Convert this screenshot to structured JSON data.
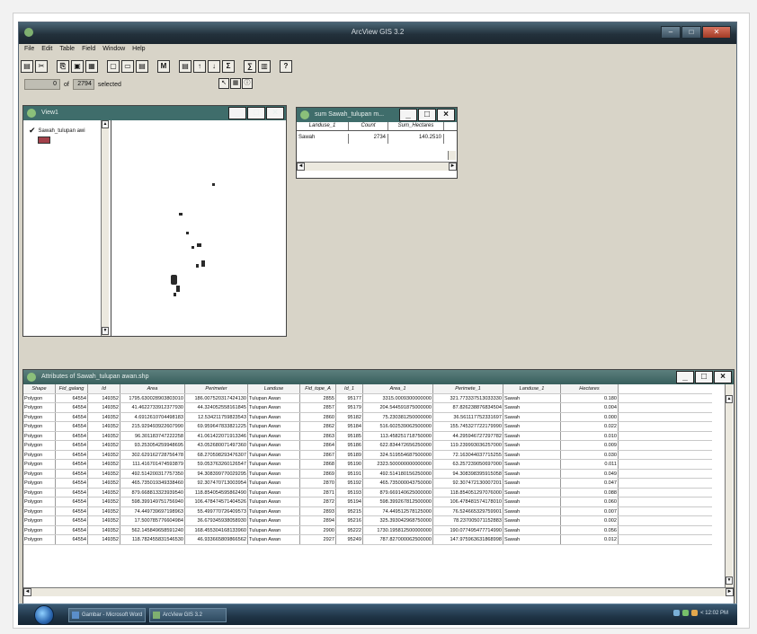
{
  "app": {
    "title": "ArcView GIS 3.2",
    "menu": [
      "File",
      "Edit",
      "Table",
      "Field",
      "Window",
      "Help"
    ],
    "toolbar_icons": [
      "save-icon",
      "cut-icon",
      "copy-icon",
      "paste-icon",
      "table-icon",
      "select-all-icon",
      "clear-selection-icon",
      "promote-icon",
      "query-icon",
      "find-icon",
      "sort-ascending-icon",
      "sort-descending-icon",
      "summarize-icon",
      "calculate-icon",
      "chart-icon",
      "help-icon"
    ],
    "toolbar_glyphs": [
      "▤",
      "✂",
      "⎘",
      "▣",
      "▦",
      "▢",
      "▭",
      "▤",
      "M",
      "▤",
      "↑",
      "↓",
      "Σ",
      "∑",
      "▥",
      "?"
    ],
    "selection": {
      "count": "0",
      "of_label": "of",
      "total": "2794",
      "selected_label": "selected"
    },
    "select_tools": [
      "↖",
      "▦",
      "ⓘ"
    ]
  },
  "view": {
    "title": "View1",
    "theme_label": "Sawah_tulupan awi",
    "controls": [
      "_",
      "□",
      "×"
    ]
  },
  "summary": {
    "title": "sum Sawah_tulupan m...",
    "columns": [
      "Landuse_1",
      "Count",
      "Sum_Hectares"
    ],
    "rows": [
      [
        "Sawah",
        "2734",
        "140.2510"
      ]
    ],
    "controls": [
      "_",
      "□",
      "×"
    ]
  },
  "attributes": {
    "title": "Attributes of Sawah_tulupan awan.shp",
    "controls": [
      "_",
      "□",
      "×"
    ],
    "columns": [
      "Shape",
      "Fid_galang",
      "Id",
      "Area",
      "Perimeter",
      "Landuse",
      "Fid_tope_A",
      "Id_1",
      "Area_1",
      "Perimete_1",
      "Landuse_1",
      "Hectares"
    ],
    "rows": [
      [
        "Polygon",
        "64554",
        "149352",
        "1795.630028903803010",
        "186.007520317424130",
        "Tulupan Awan",
        "2855",
        "95177",
        "3315.0009300000000",
        "321.773337513033330",
        "Sawah",
        "0.180"
      ],
      [
        "Polygon",
        "64554",
        "149352",
        "41.4622733912377930",
        "44.324052558161845",
        "Tulupan Awan",
        "2857",
        "95179",
        "204.544591875000000",
        "87.826238876834504",
        "Sawah",
        "0.004"
      ],
      [
        "Polygon",
        "64554",
        "149352",
        "4.6912610704498183",
        "12.534211759823543",
        "Tulupan Awan",
        "2860",
        "95182",
        "75.230381250000000",
        "36.561117752331697",
        "Sawah",
        "0.000"
      ],
      [
        "Polygon",
        "64554",
        "149352",
        "215.929493922607990",
        "69.959647833821225",
        "Tulupan Awan",
        "2862",
        "95184",
        "516.602539062500000",
        "155.745327722179990",
        "Sawah",
        "0.022"
      ],
      [
        "Polygon",
        "64554",
        "149352",
        "96.301183747222258",
        "41.061422071913346",
        "Tulupan Awan",
        "2863",
        "95185",
        "113.458251718750000",
        "44.295946727297782",
        "Sawah",
        "0.010"
      ],
      [
        "Polygon",
        "64554",
        "149352",
        "93.253054259948695",
        "43.052680071497360",
        "Tulupan Awan",
        "2864",
        "95186",
        "622.834472656250000",
        "119.239993036257000",
        "Sawah",
        "0.009"
      ],
      [
        "Polygon",
        "64554",
        "149352",
        "302.629162728756478",
        "68.270598293476307",
        "Tulupan Awan",
        "2867",
        "95189",
        "324.519554687500000",
        "72.163044037715255",
        "Sawah",
        "0.030"
      ],
      [
        "Polygon",
        "64554",
        "149352",
        "111.416701474593879",
        "59.053763260126547",
        "Tulupan Awan",
        "2868",
        "95190",
        "2323.500000000000000",
        "63.257239050697000",
        "Sawah",
        "0.011"
      ],
      [
        "Polygon",
        "64554",
        "149352",
        "492.514200317757350",
        "94.308399770029295",
        "Tulupan Awan",
        "2869",
        "95191",
        "492.514180156250000",
        "94.308398395915058",
        "Sawah",
        "0.049"
      ],
      [
        "Polygon",
        "64554",
        "149352",
        "465.735019349338460",
        "92.307470713003954",
        "Tulupan Awan",
        "2870",
        "95192",
        "465.735000043750000",
        "92.307472130007201",
        "Sawah",
        "0.047"
      ],
      [
        "Polygon",
        "64554",
        "149352",
        "879.668813323939540",
        "118.854054595862490",
        "Tulupan Awan",
        "2871",
        "95193",
        "879.669140625000000",
        "118.854051297076000",
        "Sawah",
        "0.088"
      ],
      [
        "Polygon",
        "64554",
        "149352",
        "598.399149751756940",
        "106.478474571404526",
        "Tulupan Awan",
        "2872",
        "95194",
        "598.399267812500000",
        "106.478481574178010",
        "Sawah",
        "0.060"
      ],
      [
        "Polygon",
        "64554",
        "149352",
        "74.449739697198963",
        "55.499770726409573",
        "Tulupan Awan",
        "2893",
        "95215",
        "74.449512578125000",
        "76.524665329759901",
        "Sawah",
        "0.007"
      ],
      [
        "Polygon",
        "64554",
        "149352",
        "17.500785776604984",
        "36.679345938058930",
        "Tulupan Awan",
        "2894",
        "95216",
        "325.393042968750000",
        "78.237005071152883",
        "Sawah",
        "0.002"
      ],
      [
        "Polygon",
        "64554",
        "149352",
        "562.145849658591240",
        "168.455304168133960",
        "Tulupan Awan",
        "2900",
        "95222",
        "1730.195812500000000",
        "190.077495477714990",
        "Sawah",
        "0.056"
      ],
      [
        "Polygon",
        "64554",
        "149352",
        "118.782455831546530",
        "46.933665809866562",
        "Tulupan Awan",
        "2927",
        "95249",
        "787.827000062500000",
        "147.975963631868998",
        "Sawah",
        "0.012"
      ]
    ]
  },
  "taskbar": {
    "items": [
      "Gambar - Microsoft Word",
      "ArcView GIS 3.2"
    ],
    "tray_text": "< 12:02 PM"
  }
}
